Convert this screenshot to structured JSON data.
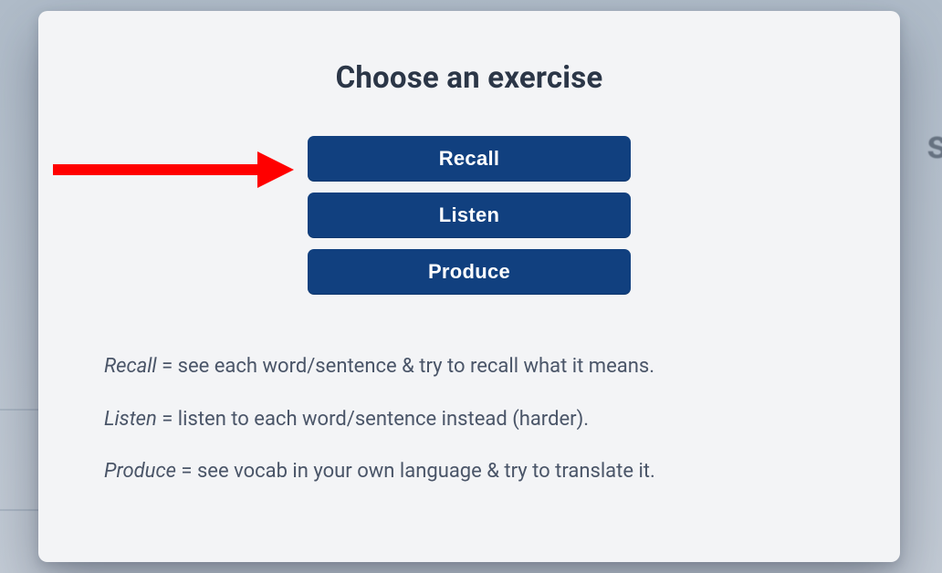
{
  "modal": {
    "title": "Choose an exercise",
    "buttons": {
      "recall": "Recall",
      "listen": "Listen",
      "produce": "Produce"
    },
    "descriptions": {
      "recall": {
        "term": "Recall",
        "eq": " = ",
        "text": "see each word/sentence & try to recall what it means."
      },
      "listen": {
        "term": "Listen",
        "eq": " = ",
        "text": "listen to each word/sentence instead (harder)."
      },
      "produce": {
        "term": "Produce",
        "eq": " = ",
        "text": "see vocab in your own language & try to translate it."
      }
    }
  },
  "background": {
    "glimpse_char": "s"
  },
  "annotation": {
    "arrow_color": "#ff0000",
    "points_to": "recall-button"
  }
}
